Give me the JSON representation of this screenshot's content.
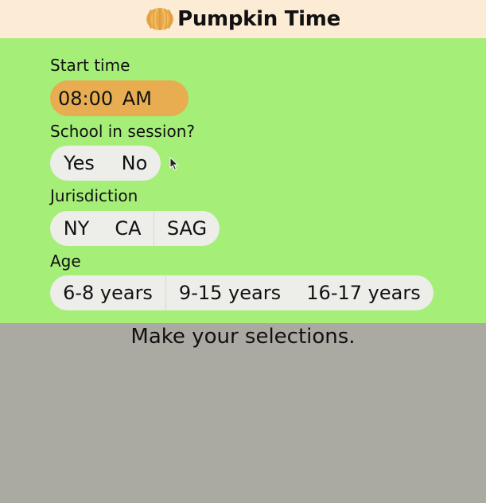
{
  "app": {
    "title": "Pumpkin Time",
    "logo_icon": "pumpkin-icon"
  },
  "form": {
    "start_time": {
      "label": "Start time",
      "value": "08:00 AM"
    },
    "school": {
      "label": "School in session?",
      "options": [
        "Yes",
        "No"
      ]
    },
    "jurisdiction": {
      "label": "Jurisdiction",
      "options": [
        "NY",
        "CA",
        "SAG"
      ]
    },
    "age": {
      "label": "Age",
      "options": [
        "6-8 years",
        "9-15 years",
        "16-17 years"
      ]
    }
  },
  "status": {
    "message": "Make your selections."
  },
  "colors": {
    "header_bg": "#fcecd6",
    "panel_bg": "#a5ee78",
    "time_pill_bg": "#e8ad50",
    "option_bg": "#ededea",
    "footer_bg": "#aaaaa2"
  }
}
